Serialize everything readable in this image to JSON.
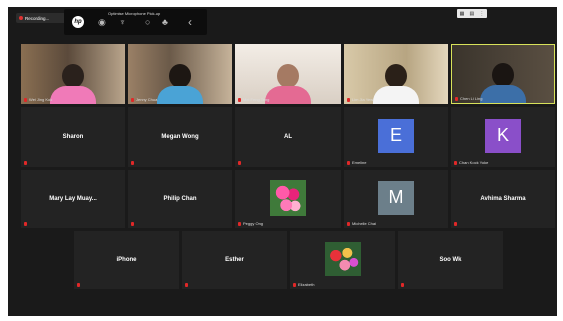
{
  "recording": {
    "label": "Recording..."
  },
  "device_toolbar": {
    "title": "Optimise Microphone Pick-up",
    "logo": "hp",
    "icons": [
      "radio-icon",
      "mic-icon",
      "radio-icon",
      "mic-array-icon",
      "chevron-left-icon"
    ]
  },
  "view_controls": {
    "icons": [
      "grid-icon",
      "layout-icon",
      "more-icon"
    ]
  },
  "colors": {
    "active_speaker_border": "#d8e25a",
    "avatar_e": "#4a6fd8",
    "avatar_k": "#8a4fc9",
    "avatar_m": "#6c7f8a",
    "mute": "#e02828"
  },
  "participants": [
    {
      "id": "p1",
      "footer": "Wei Jing Kok"
    },
    {
      "id": "p2",
      "footer": "Jenny Chua"
    },
    {
      "id": "p3",
      "footer": "Mei Feng Teng"
    },
    {
      "id": "p4",
      "footer": "Lim Jia Yew"
    },
    {
      "id": "p5",
      "footer": "Chen Li Ling"
    },
    {
      "id": "sharon",
      "name": "Sharon"
    },
    {
      "id": "megan",
      "name": "Megan Wong"
    },
    {
      "id": "al",
      "name": "AL"
    },
    {
      "id": "emeline",
      "letter": "E",
      "footer": "Emeline"
    },
    {
      "id": "chen",
      "letter": "K",
      "footer": "Chan Kock Yoke"
    },
    {
      "id": "mary",
      "name": "Mary Lay Muay..."
    },
    {
      "id": "philip",
      "name": "Philip Chan"
    },
    {
      "id": "peggy",
      "footer": "Peggy Ong"
    },
    {
      "id": "michelle",
      "letter": "M",
      "footer": "Michelle Chai"
    },
    {
      "id": "avhima",
      "name": "Avhima Sharma"
    },
    {
      "id": "iphone",
      "name": "iPhone"
    },
    {
      "id": "esther",
      "name": "Esther"
    },
    {
      "id": "elizabeth",
      "footer": "Elizabeth"
    },
    {
      "id": "soowk",
      "name": "Soo Wk"
    }
  ]
}
